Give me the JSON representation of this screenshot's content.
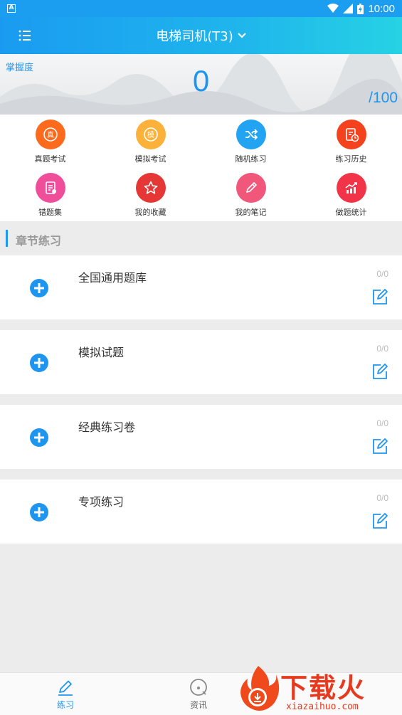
{
  "status_bar": {
    "time": "10:00",
    "notif_icon": "A"
  },
  "header": {
    "title": "电梯司机(T3)",
    "chevron": "⌄"
  },
  "banner": {
    "mastery_label": "掌握度",
    "score": "0",
    "total": "/100"
  },
  "grid": [
    {
      "label": "真题考试",
      "icon": "exam-real-icon",
      "glyph": "真",
      "color": "#fb6a1d"
    },
    {
      "label": "模拟考试",
      "icon": "exam-mock-icon",
      "glyph": "模",
      "color": "#fbb13a"
    },
    {
      "label": "随机练习",
      "icon": "shuffle-icon",
      "glyph": "",
      "color": "#22a4f3"
    },
    {
      "label": "练习历史",
      "icon": "history-icon",
      "glyph": "",
      "color": "#f5421e"
    },
    {
      "label": "错题集",
      "icon": "wrong-questions-icon",
      "glyph": "",
      "color": "#f04d9b"
    },
    {
      "label": "我的收藏",
      "icon": "star-icon",
      "glyph": "",
      "color": "#e53735"
    },
    {
      "label": "我的笔记",
      "icon": "pencil-icon",
      "glyph": "",
      "color": "#f0577a"
    },
    {
      "label": "做题统计",
      "icon": "stats-icon",
      "glyph": "",
      "color": "#f23448"
    }
  ],
  "section": {
    "title": "章节练习"
  },
  "cards": [
    {
      "name": "全国通用题库",
      "count": "0/0"
    },
    {
      "name": "模拟试题",
      "count": "0/0"
    },
    {
      "name": "经典练习卷",
      "count": "0/0"
    },
    {
      "name": "专项练习",
      "count": "0/0"
    }
  ],
  "bottom_nav": [
    {
      "label": "练习",
      "active": true
    },
    {
      "label": "资讯",
      "active": false
    }
  ],
  "watermark": {
    "text": "下载火",
    "sub": "xiazaihuo.com"
  },
  "colors": {
    "accent": "#2196f3",
    "header_start": "#1a9bf1",
    "header_end": "#27d2e4"
  }
}
